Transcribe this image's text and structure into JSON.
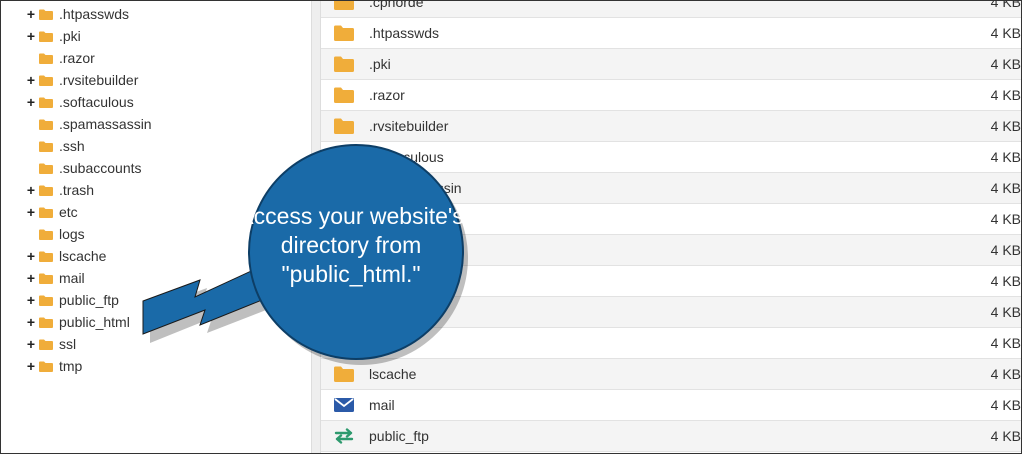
{
  "tree": {
    "items": [
      {
        "label": ".htpasswds",
        "expand": "+"
      },
      {
        "label": ".pki",
        "expand": "+"
      },
      {
        "label": ".razor",
        "expand": ""
      },
      {
        "label": ".rvsitebuilder",
        "expand": "+"
      },
      {
        "label": ".softaculous",
        "expand": "+"
      },
      {
        "label": ".spamassassin",
        "expand": ""
      },
      {
        "label": ".ssh",
        "expand": ""
      },
      {
        "label": ".subaccounts",
        "expand": ""
      },
      {
        "label": ".trash",
        "expand": "+"
      },
      {
        "label": "etc",
        "expand": "+"
      },
      {
        "label": "logs",
        "expand": ""
      },
      {
        "label": "lscache",
        "expand": "+"
      },
      {
        "label": "mail",
        "expand": "+"
      },
      {
        "label": "public_ftp",
        "expand": "+"
      },
      {
        "label": "public_html",
        "expand": "+"
      },
      {
        "label": "ssl",
        "expand": "+"
      },
      {
        "label": "tmp",
        "expand": "+"
      }
    ]
  },
  "file_list": {
    "rows": [
      {
        "name": ".cpnorde",
        "size": "4 KB",
        "icon": "folder-icon"
      },
      {
        "name": ".htpasswds",
        "size": "4 KB",
        "icon": "folder-icon"
      },
      {
        "name": ".pki",
        "size": "4 KB",
        "icon": "folder-icon"
      },
      {
        "name": ".razor",
        "size": "4 KB",
        "icon": "folder-icon"
      },
      {
        "name": ".rvsitebuilder",
        "size": "4 KB",
        "icon": "folder-icon"
      },
      {
        "name": ".softaculous",
        "size": "4 KB",
        "icon": "folder-icon"
      },
      {
        "name": ".spamassassin",
        "size": "4 KB",
        "icon": "folder-icon"
      },
      {
        "name": "",
        "size": "4 KB",
        "icon": "folder-icon"
      },
      {
        "name": "",
        "size": "4 KB",
        "icon": "folder-icon"
      },
      {
        "name": "",
        "size": "4 KB",
        "icon": "folder-icon"
      },
      {
        "name": "",
        "size": "4 KB",
        "icon": "folder-icon"
      },
      {
        "name": "",
        "size": "4 KB",
        "icon": "folder-icon"
      },
      {
        "name": "lscache",
        "size": "4 KB",
        "icon": "folder-icon"
      },
      {
        "name": "mail",
        "size": "4 KB",
        "icon": "mail-icon"
      },
      {
        "name": "public_ftp",
        "size": "4 KB",
        "icon": "transfer-arrows-icon"
      }
    ]
  },
  "callout": {
    "text": "Access your website's directory from \"public_html.\""
  },
  "colors": {
    "folder": "#f0ad3a",
    "callout_fill": "#1a6aa8",
    "mail_icon": "#2b5aa8",
    "transfer_icon": "#2e9a6e"
  }
}
